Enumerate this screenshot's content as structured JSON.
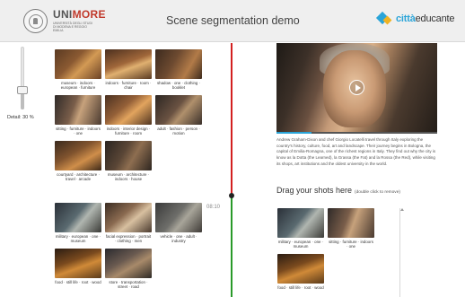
{
  "header": {
    "university_name_part1": "UNI",
    "university_name_part2": "MORE",
    "university_subtitle": "UNIVERSITÀ DEGLI STUDI DI MODENA E REGGIO EMILIA",
    "title": "Scene segmentation demo",
    "partner_name_part1": "città",
    "partner_name_part2": "educante"
  },
  "detail": {
    "label": "Detail: 30 %",
    "value_percent": 30
  },
  "timeline": {
    "time_label": "08:10"
  },
  "scenes_top": [
    {
      "label": "museum · indoors · european · furniture",
      "tone": "t-a"
    },
    {
      "label": "indoors · furniture · room · chair",
      "tone": "t-b"
    },
    {
      "label": "shadow · one · clothing · booklet",
      "tone": "t-c"
    },
    {
      "label": "sitting · furniture · indoors · one",
      "tone": "t-d"
    },
    {
      "label": "indoors · interior design · furniture · room",
      "tone": "t-e"
    },
    {
      "label": "adult · fashion · person · motion",
      "tone": "t-f"
    },
    {
      "label": "courtyard · architecture · travel · arcade",
      "tone": "t-g"
    },
    {
      "label": "museum · architecture · indoors · house",
      "tone": "t-h"
    }
  ],
  "scenes_bottom": [
    {
      "label": "military · european · one · museum",
      "tone": "t-i"
    },
    {
      "label": "facial expression · portrait · clothing · men",
      "tone": "t-j"
    },
    {
      "label": "vehicle · one · adult · industry",
      "tone": "t-k"
    },
    {
      "label": "food · still life · root · wood",
      "tone": "t-l"
    },
    {
      "label": "store · transportation · street · road",
      "tone": "t-m"
    }
  ],
  "video": {
    "progress_percent": 22,
    "description": "Andrew Graham-Dixon and chef Giorgio Locatelli travel through Italy exploring the country's history, culture, food, art and landscape. Their journey begins in Bologna, the capital of Emilia-Romagna, one of the richest regions in Italy. They find out why the city is know as la Dotta (the Learned), la Grassa (the Fat) and la Rossa (the Red), while visiting its shops, art institutions and the oldest university in the world."
  },
  "drop": {
    "title": "Drag your shots here",
    "hint": "(double click to remove)",
    "shots": [
      {
        "label": "military · european · one · museum",
        "tone": "t-i"
      },
      {
        "label": "sitting · furniture · indoors · one",
        "tone": "t-d"
      },
      {
        "label": "food · still life · root · wood",
        "tone": "t-l"
      }
    ]
  }
}
